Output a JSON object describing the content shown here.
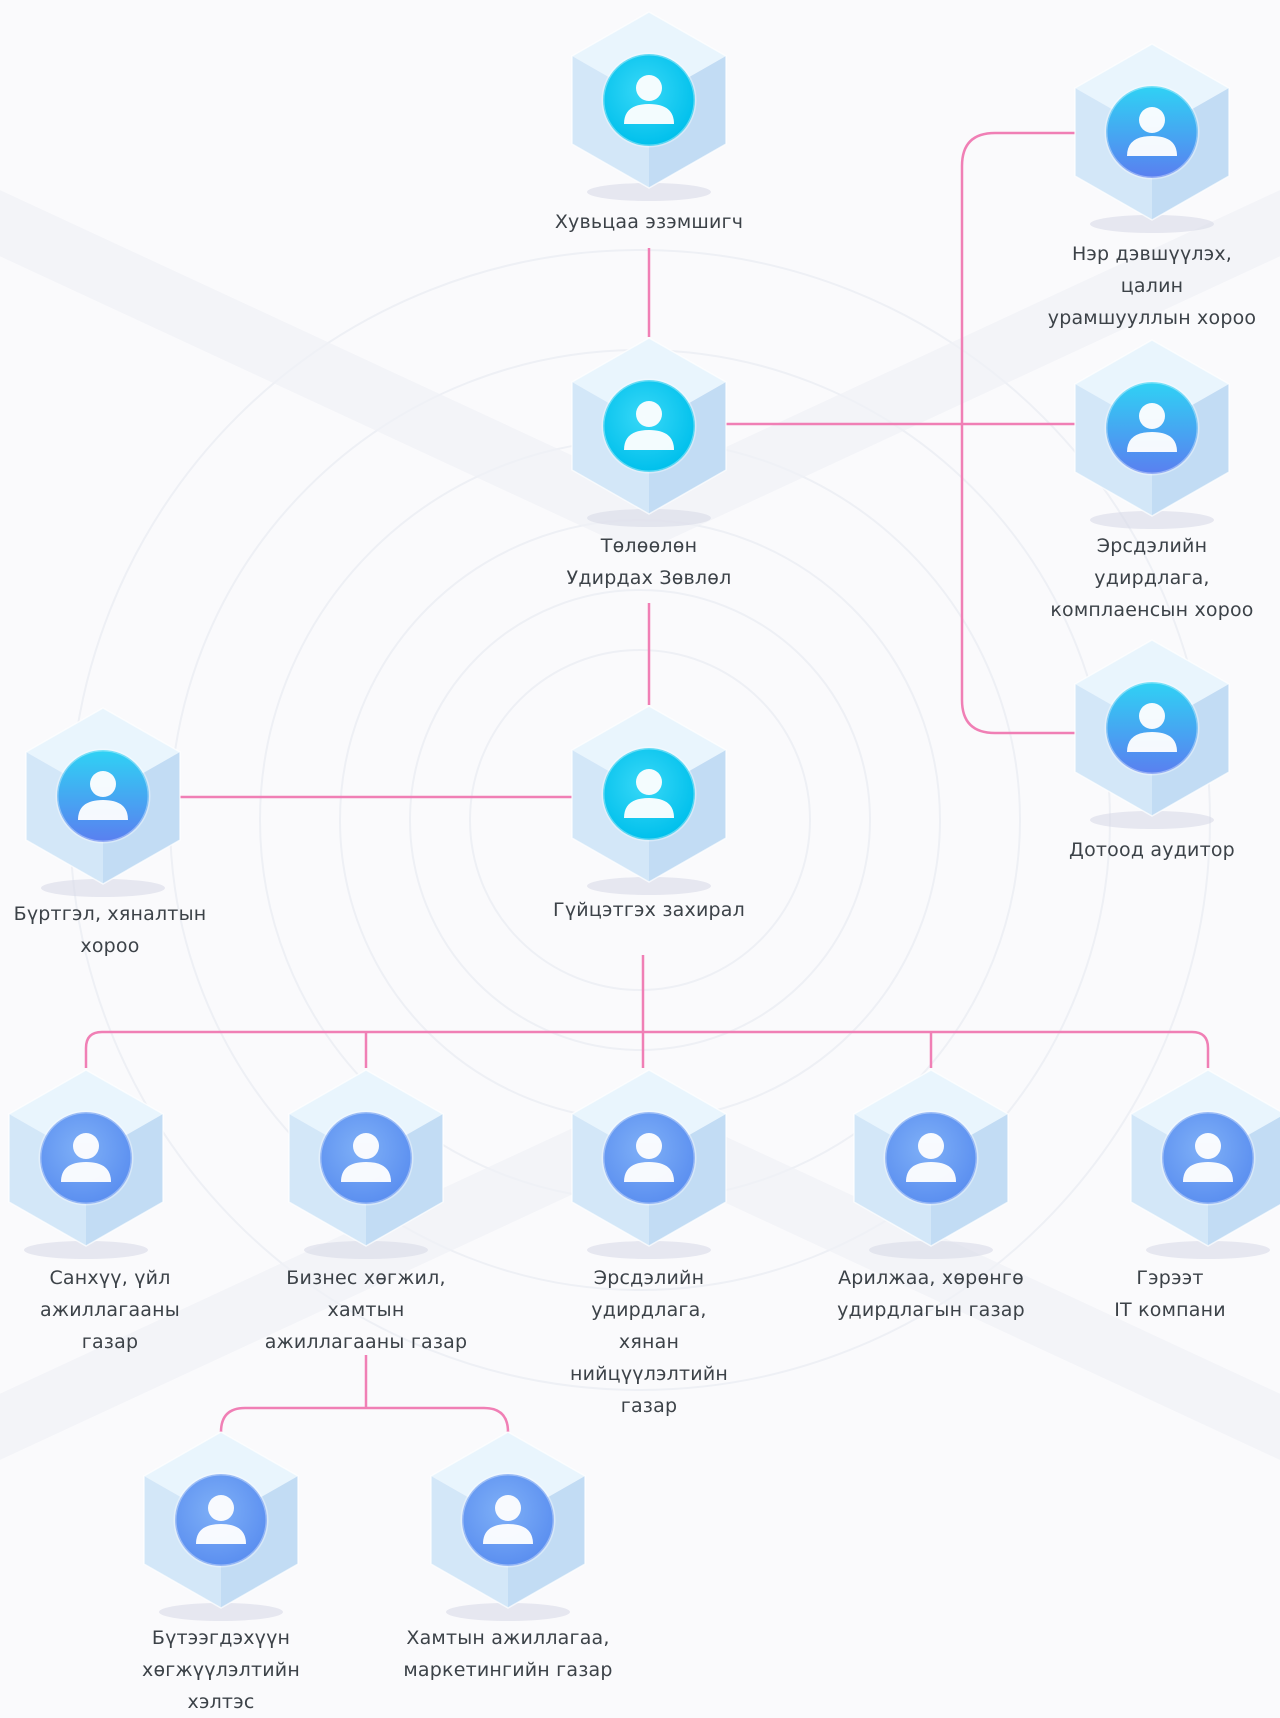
{
  "diagram": {
    "type": "org-chart",
    "colors": {
      "connector": "#f07fb5",
      "cube_top": "#e9f5fd",
      "cube_left": "#d3e7f8",
      "cube_right": "#c2dcf4",
      "avatar_cyan": "#00c0ec",
      "avatar_blue": "#5b8ff0",
      "label_text": "#3c4248"
    },
    "icon": "user-icon",
    "nodes": [
      {
        "id": "shareholder",
        "label": "Хувьцаа эзэмшигч",
        "style": "cyan"
      },
      {
        "id": "board",
        "label": "Төлөөлөн\nУдирдах Зөвлөл",
        "style": "cyan"
      },
      {
        "id": "ceo",
        "label": "Гүйцэтгэх захирал",
        "style": "cyan"
      },
      {
        "id": "nomination",
        "label": "Нэр дэвшүүлэх, цалин\nурамшууллын хороо",
        "style": "mixed"
      },
      {
        "id": "risk_committee",
        "label": "Эрсдэлийн удирдлага,\nкомплаенсын хороо",
        "style": "mixed"
      },
      {
        "id": "internal_audit",
        "label": "Дотоод аудитор",
        "style": "mixed"
      },
      {
        "id": "registration",
        "label": "Бүртгэл, хяналтын\nхороо",
        "style": "mixed"
      },
      {
        "id": "finance",
        "label": "Санхүү, үйл\nажиллагааны\nгазар",
        "style": "blue"
      },
      {
        "id": "bizdev",
        "label": "Бизнес хөгжил,\nхамтын\nажиллагааны газар",
        "style": "blue"
      },
      {
        "id": "risk_mgmt",
        "label": "Эрсдэлийн удирдлага,\nхянан\nнийцүүлэлтийн газар",
        "style": "blue"
      },
      {
        "id": "trading",
        "label": "Арилжаа, хөрөнгө\nудирдлагын газар",
        "style": "blue"
      },
      {
        "id": "it",
        "label": "Гэрээт\nIT компани",
        "style": "blue"
      },
      {
        "id": "product",
        "label": "Бүтээгдэхүүн\nхөгжүүлэлтийн\nхэлтэс",
        "style": "blue"
      },
      {
        "id": "marketing",
        "label": "Хамтын ажиллагаа,\nмаркетингийн газар",
        "style": "blue"
      }
    ],
    "edges": [
      [
        "shareholder",
        "board"
      ],
      [
        "board",
        "ceo"
      ],
      [
        "board",
        "nomination"
      ],
      [
        "board",
        "risk_committee"
      ],
      [
        "board",
        "internal_audit"
      ],
      [
        "ceo",
        "registration"
      ],
      [
        "ceo",
        "finance"
      ],
      [
        "ceo",
        "bizdev"
      ],
      [
        "ceo",
        "risk_mgmt"
      ],
      [
        "ceo",
        "trading"
      ],
      [
        "ceo",
        "it"
      ],
      [
        "bizdev",
        "product"
      ],
      [
        "bizdev",
        "marketing"
      ]
    ]
  }
}
